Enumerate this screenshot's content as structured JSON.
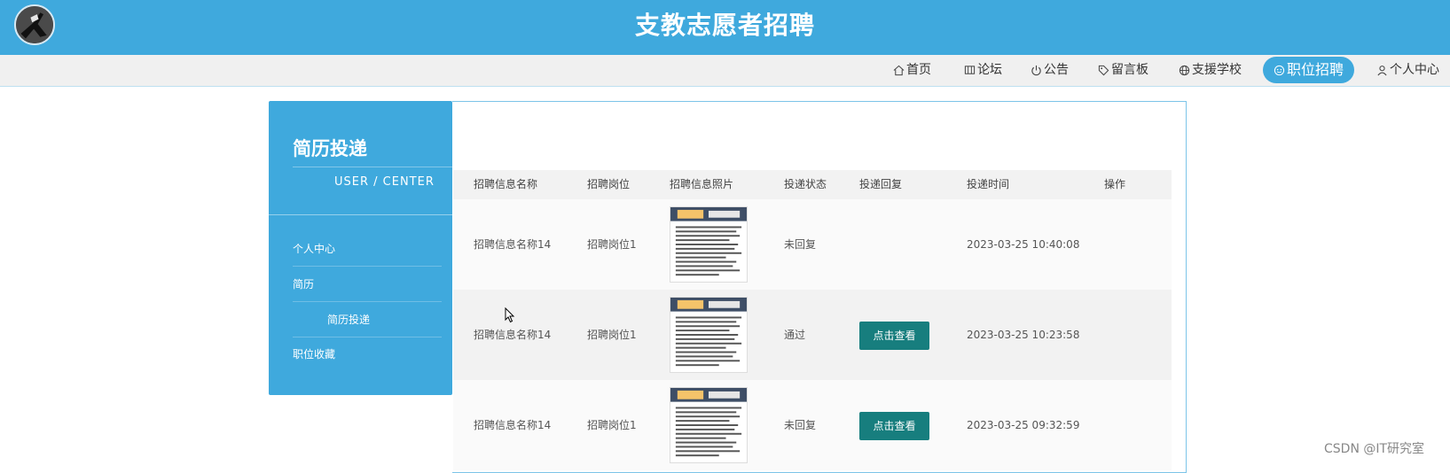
{
  "header": {
    "site_title": "支教志愿者招聘",
    "logo_icon": "logo-icon"
  },
  "nav": {
    "items": [
      {
        "label": "首页",
        "icon": "home-icon"
      },
      {
        "label": "论坛",
        "icon": "forum-icon"
      },
      {
        "label": "公告",
        "icon": "power-icon"
      },
      {
        "label": "留言板",
        "icon": "tag-icon"
      },
      {
        "label": "支援学校",
        "icon": "globe-icon"
      },
      {
        "label": "职位招聘",
        "icon": "smile-icon",
        "active": true
      },
      {
        "label": "个人中心",
        "icon": "user-icon"
      }
    ],
    "active_color": "#3fa9dd"
  },
  "sidebar": {
    "title": "简历投递",
    "subtitle": "USER / CENTER",
    "items": [
      {
        "label": "个人中心"
      },
      {
        "label": "简历"
      },
      {
        "label": "简历投递"
      },
      {
        "label": "职位收藏"
      }
    ],
    "bg_color": "#3fa9dd"
  },
  "table": {
    "headers": [
      "招聘信息名称",
      "招聘岗位",
      "招聘信息照片",
      "投递状态",
      "投递回复",
      "投递时间",
      "操作"
    ],
    "rows": [
      {
        "name": "招聘信息名称14",
        "position": "招聘岗位1",
        "photo": "thumbnail-image",
        "status": "未回复",
        "reply": "",
        "time": "2023-03-25 10:40:08",
        "action": ""
      },
      {
        "name": "招聘信息名称14",
        "position": "招聘岗位1",
        "photo": "thumbnail-image",
        "status": "通过",
        "reply": "点击查看",
        "time": "2023-03-25 10:23:58",
        "action": ""
      },
      {
        "name": "招聘信息名称14",
        "position": "招聘岗位1",
        "photo": "thumbnail-image",
        "status": "未回复",
        "reply": "点击查看",
        "time": "2023-03-25 09:32:59",
        "action": ""
      }
    ],
    "button_color": "#177e7e"
  },
  "watermark": "CSDN @IT研究室"
}
